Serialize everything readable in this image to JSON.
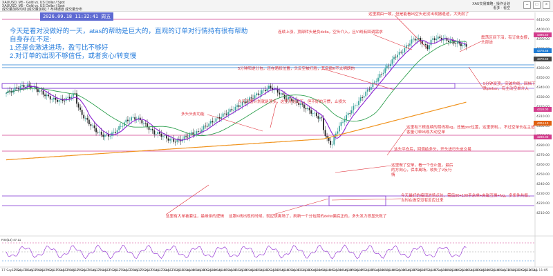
{
  "toolbar": {
    "line1": "XAUUSD, M5 · Gold vs. US Dollar / Spot",
    "line2": "XAUUSD, M5 · Gold vs. US Dollar | Spot",
    "line3": "成交量加权均线 [成交量加权] 7 布林通道 成交量分布",
    "right_text": "XAU交易策略 · 操作计划",
    "right_sub": "看多 · 看空"
  },
  "timestamp": "2026.09.18 11:32:41 周五",
  "notes": {
    "l1": "今天是看对没做好的一天，atas的帮助是巨大的，直观的订单对行情持有很有帮助",
    "l2": "自身存在不足:",
    "l3": "1.还是会激进进场，盈亏比不够好",
    "l4": "2.对订单的出现不够信任，或者贪心/转变慢"
  },
  "annotations": {
    "a1": "这里拥由一致，但是能看出空头还没出现撤退迹，大失耐了",
    "a2": "连续上涨，顶部转头是负delta，空头介入，且VI线有回调需求",
    "a3": "震荡区间下沿，有订单支撑，头部迹",
    "a4": "5分钟阳逆分包，还在晒权位置，头反空被打脸，其实撤K不太明朗的",
    "a5": "5分钟双顶，突破均线，回档下跌pinbar，有主动空单介入",
    "a6": "今天开盘计划就是顶多，这里开始马丁，但不好的习惯，止损大",
    "a7": "多头头皮功能",
    "a8": "这里有三根连续的阴线和vg，还是poc位置，这里获利。，不过空单去在主迹客量订单出现大动空单",
    "a9": "这头平仓后，回调给多头，开头进行头皮交易",
    "a10": "这里做了空单，看一个仓止盈，最后的方向心，保本离场，收失了V反行情",
    "a11": "今天最好的接现进场点位，需后90+100手余单+夹磁互换+fvg，多条件共振，当时在做空没有反应过来",
    "a12": "这里有大单被套住，最缘亲的逻辑",
    "a13": "这跟K线出现的时候，就应该离场了，刷新一个分包阴的delta偏底正的，多头发力很显失败了"
  },
  "price_axis": [
    "4410.00",
    "4400.00",
    "4390.00",
    "4380.00",
    "4370.00",
    "4360.00",
    "4350.00",
    "4340.00",
    "4330.00",
    "4320.00",
    "4310.00",
    "4300.00",
    "4290.00",
    "4280.00",
    "4270.00",
    "4260.00",
    "4250.00",
    "4240.00",
    "4230.00",
    "4220.00",
    "4210.00"
  ],
  "price_tags": [
    {
      "label": "4395.50",
      "color": "#d23c8c"
    },
    {
      "label": "4378.58",
      "color": "#1e7ad2"
    },
    {
      "label": "4370.50",
      "color": "#444444"
    },
    {
      "label": "4318.00",
      "color": "#d23c8c"
    },
    {
      "label": "4304.10",
      "color": "#e06010"
    },
    {
      "label": "4290.00",
      "color": "#d23c8c"
    }
  ],
  "time_axis": [
    "17 Sep 2026",
    "17 Sep 18:45",
    "17 Sep 19:05",
    "17 Sep 19:25",
    "17 Sep 19:45",
    "17 Sep 20:05",
    "17 Sep 20:25",
    "17 Sep 20:45",
    "17 Sep 21:05",
    "17 Sep 21:25",
    "17 Sep 21:45",
    "17 Sep 22:05",
    "17 Sep 22:25",
    "17 Sep 22:45",
    "17 Sep 23:05",
    "17 Sep 23:25",
    "17 Sep 23:45",
    "18 Sep 00:05",
    "18 Sep 00:25",
    "18 Sep 00:45",
    "18 Sep 01:05",
    "18 Sep 01:25",
    "18 Sep 01:45",
    "18 Sep 02:05",
    "18 Sep 02:25",
    "18 Sep 02:45",
    "18 Sep 03:05",
    "18 Sep 03:25",
    "18 Sep 03:45",
    "18 Sep 04:05",
    "18 Sep 04:25",
    "18 Sep 04:45",
    "18 Sep 05:05",
    "18 Sep 05:25",
    "18 Sep 05:45",
    "18 Sep 06:05",
    "18 Sep 06:25",
    "18 Sep 06:45",
    "18 Sep 07:05",
    "18 Sep 07:25",
    "18 Sep 07:45",
    "18 Sep 08:05",
    "18 Sep 08:25",
    "18 Sep 08:45",
    "18 Sep 09:05",
    "18 Sep 09:25",
    "18 Sep 09:45",
    "18 Sep 10:05",
    "18 Sep 10:25",
    "18 Sep 10:45",
    "18 Sep 11:05"
  ],
  "rsi": {
    "title": "RSI(14) 47.11",
    "levels": [
      "80",
      "50",
      "20"
    ]
  },
  "colors": {
    "up": "#3aa39b",
    "down": "#222222",
    "ma_fast": "#8a1fd0",
    "ma_mid": "#2fa04f",
    "ma_slow": "#f0931e",
    "note_text": "#2a7fdd",
    "annotation_text": "#e0303a",
    "zone_line": "#7a2cd0"
  }
}
